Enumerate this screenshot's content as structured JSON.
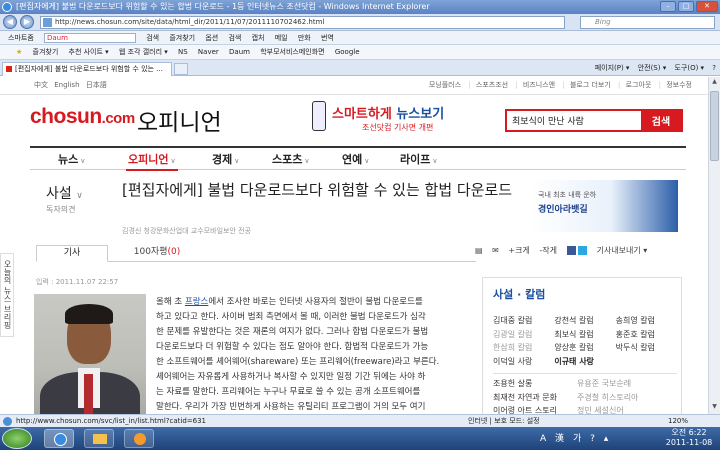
{
  "window": {
    "title": "[편집자에게] 불법 다운로드보다 위험할 수 있는 합법 다운로드 - 1등 인터넷뉴스 조선닷컴 - Windows Internet Explorer",
    "url": "http://news.chosun.com/site/data/html_dir/2011/11/07/2011110702462.html",
    "search_engine": "Bing"
  },
  "toolbar": {
    "items": [
      "스마트줌",
      "Daum",
      "검색",
      "즐겨찾기",
      "옵션",
      "검색",
      "캡처",
      "메일",
      "만화",
      "번역"
    ]
  },
  "favorites": {
    "label": "즐겨찾기",
    "items": [
      "추천 사이트 ▾",
      "웹 조각 갤러리 ▾",
      "NS",
      "Naver",
      "Daum",
      "학부모서비스메인화면",
      "Google"
    ]
  },
  "tab": {
    "title": "[편집자에게] 불법 다운로드보다 위험할 수 있는 ...",
    "commands": [
      "페이지(P) ▾",
      "안전(S) ▾",
      "도구(O) ▾",
      "?"
    ]
  },
  "site": {
    "languages": [
      "中文",
      "English",
      "日本語"
    ],
    "top_links": [
      "모닝플러스",
      "스포츠조선",
      "비즈니스앤",
      "블로그 더보기",
      "로그아웃",
      "정보수정"
    ],
    "logo_main": "chosun",
    "logo_tld": ".com",
    "section_title": "오피니언",
    "banner": {
      "headline_a": "스마트하게",
      "headline_b": " 뉴스보기",
      "sub": "조선닷컴 기사면 개편"
    },
    "search": {
      "value": "최보식이 만난 사람",
      "button": "검색"
    },
    "gnb": [
      "뉴스",
      "오피니언",
      "경제",
      "스포츠",
      "연예",
      "라이프"
    ]
  },
  "article": {
    "section": "사설",
    "section_sub": "독자의견",
    "title": "[편집자에게] 불법 다운로드보다 위험할 수 있는 합법 다운로드",
    "byline": "김경신 청강문화산업대 교수모바일보안 전공",
    "tabs": {
      "article": "기사",
      "comments_prefix": "100자평",
      "comments_count": "(0)"
    },
    "tools": [
      "+크게",
      "-작게",
      "기사내보내기 ▾"
    ],
    "date": "입력 : 2011.11.07 22:57",
    "body_lines": [
      "올해 초 ",
      "에서 조사한 바로는 인터넷 사용자의 절반이 불법 다운로드를",
      "하고 있다고 한다. 사이버 범죄 측면에서 볼 때, 이러한 불법 다운로드가 심각",
      "한 문제를 유발한다는 것은 재론의 여지가 없다. 그러나 합법 다운로드가 불법",
      "다운로드보다 더 위험할 수 있다는 점도 알아야 한다. 합법적 다운로드가 가능",
      "한 소프트웨어를 셰어웨어(shareware) 또는 프리웨어(freeware)라고 부른다.",
      "셰어웨어는 자유롭게 사용하거나 복사할 수 있지만 일정 기간 뒤에는 사야 하",
      "는 자료를 말한다. 프리웨어는 누구나 무료로 쓸 수 있는 공개 소프트웨어를",
      "말한다. 우리가 가장 빈번하게 사용하는 유틸리티 프로그램이 거의 모두 여기"
    ],
    "body_link": "프랑스",
    "side_tab": "오늘의 뉴스 브리핑"
  },
  "right_panel": {
    "title": "사설 · 칼럼",
    "rows": [
      [
        "김대중 칼럼",
        "강천석 칼럼",
        "송희영 칼럼"
      ],
      [
        "김광일 칼럼",
        "최보식 칼럼",
        "홍준호 칼럼"
      ],
      [
        "한삼희 칼럼",
        "양상훈 칼럼",
        "박두식 칼럼"
      ],
      [
        "이덕일 사랑",
        "이규태 사랑",
        ""
      ]
    ],
    "rows2": [
      [
        "조용헌 살롱",
        "유용준 국보순례",
        ""
      ],
      [
        "최재천 자연과 문화",
        "주경철 히스토리아",
        ""
      ],
      [
        "이어령 아트 스토리",
        "정민 세설신어",
        ""
      ]
    ]
  },
  "status": {
    "url": "http://www.chosun.com/svc/list_in/list.html?catid=631",
    "zone": "인터넷 | 보호 모드: 설정",
    "zoom": "120%"
  },
  "taskbar": {
    "tray": [
      "A",
      "漢",
      "가",
      "?",
      "▴"
    ],
    "time": "오전 6:22",
    "date": "2011-11-08"
  }
}
